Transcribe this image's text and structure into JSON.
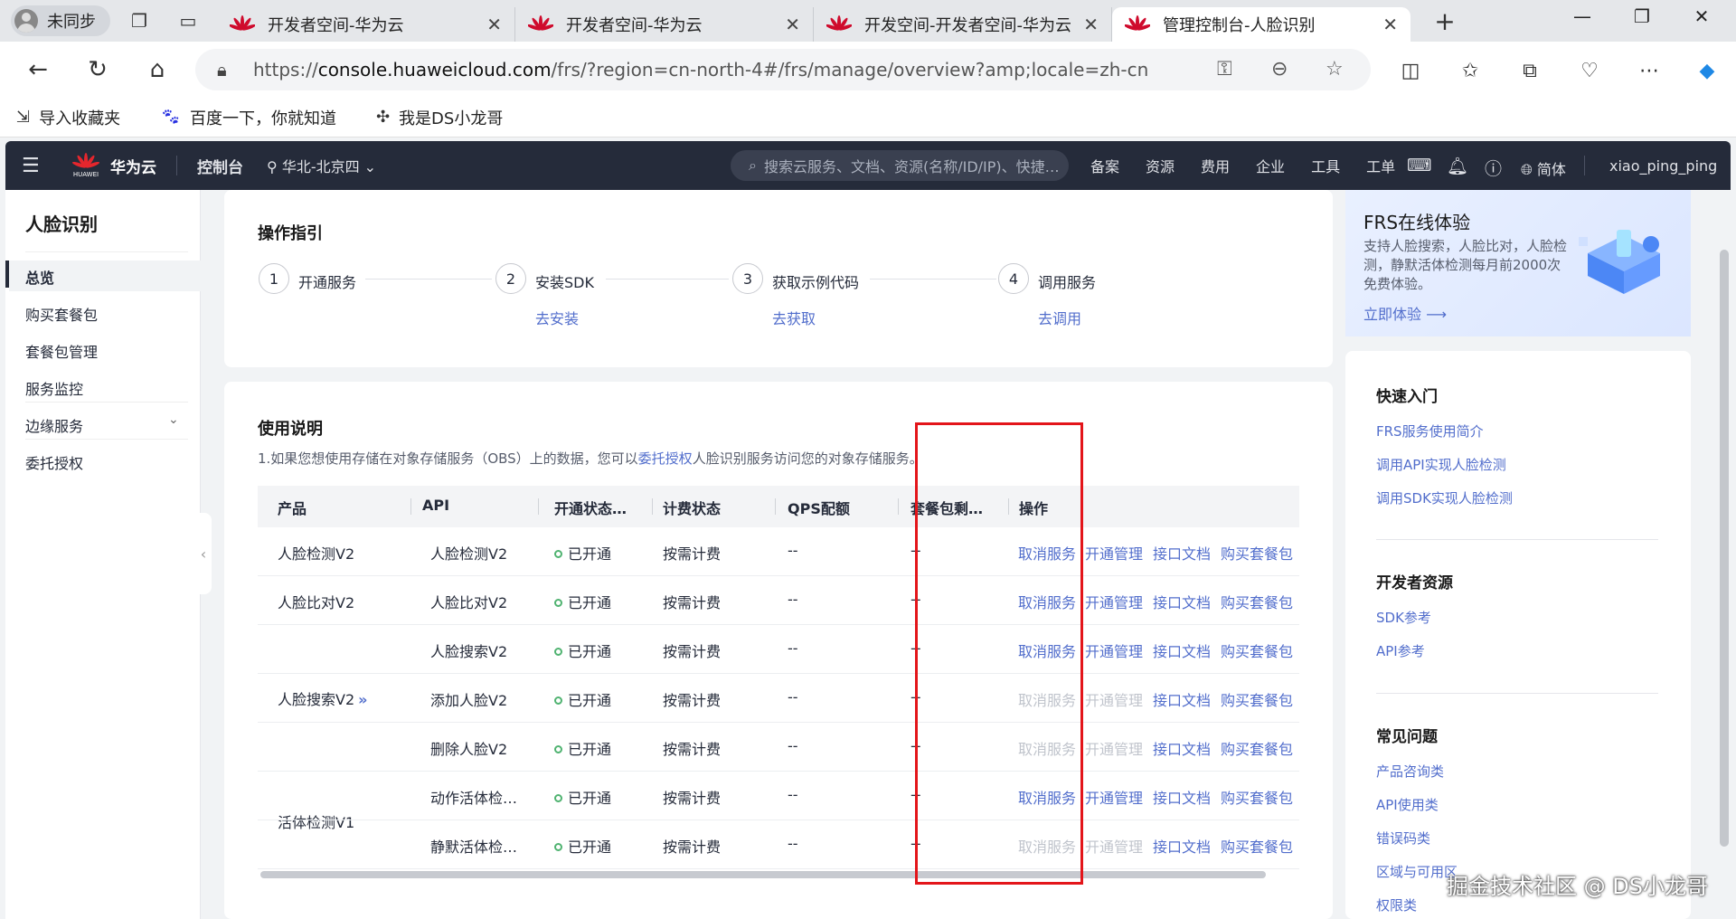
{
  "browser": {
    "profile_label": "未同步",
    "tabs": [
      {
        "label": "开发者空间-华为云"
      },
      {
        "label": "开发者空间-华为云"
      },
      {
        "label": "开发空间-开发者空间-华为云"
      },
      {
        "label": "管理控制台-人脸识别"
      }
    ],
    "url_scheme": "https://",
    "url_host": "console.huaweicloud.com",
    "url_path": "/frs/?region=cn-north-4#/frs/manage/overview?amp;locale=zh-cn",
    "bookmarks": [
      {
        "label": "导入收藏夹"
      },
      {
        "label": "百度一下，你就知道"
      },
      {
        "label": "我是DS小龙哥"
      }
    ]
  },
  "console": {
    "logo_text": "HUAWEI",
    "brand": "华为云",
    "control_label": "控制台",
    "region": "华北-北京四",
    "search_placeholder": "搜索云服务、文档、资源(名称/ID/IP)、快捷…",
    "links": [
      "备案",
      "资源",
      "费用",
      "企业",
      "工具",
      "工单"
    ],
    "language": "简体",
    "username": "xiao_ping_ping"
  },
  "sidebar": {
    "title": "人脸识别",
    "items": [
      {
        "label": "总览"
      },
      {
        "label": "购买套餐包"
      },
      {
        "label": "套餐包管理"
      },
      {
        "label": "服务监控"
      },
      {
        "label": "边缘服务"
      },
      {
        "label": "委托授权"
      }
    ]
  },
  "guide": {
    "title": "操作指引",
    "steps": [
      {
        "num": "1",
        "label": "开通服务",
        "link": ""
      },
      {
        "num": "2",
        "label": "安装SDK",
        "link": "去安装"
      },
      {
        "num": "3",
        "label": "获取示例代码",
        "link": "去获取"
      },
      {
        "num": "4",
        "label": "调用服务",
        "link": "去调用"
      }
    ]
  },
  "usage": {
    "title": "使用说明",
    "desc_before": "1.如果您想使用存储在对象存储服务（OBS）上的数据，您可以",
    "desc_link": "委托授权",
    "desc_after": "人脸识别服务访问您的对象存储服务。",
    "columns": [
      "产品",
      "API",
      "开通状态…",
      "计费状态",
      "QPS配额",
      "套餐包剩…",
      "操作"
    ],
    "products": [
      "人脸检测V2",
      "人脸比对V2",
      "人脸搜索V2",
      "活体检测V1"
    ],
    "rows": [
      {
        "api": "人脸检测V2",
        "status": "已开通",
        "billing": "按需计费",
        "qps": "--",
        "pkg": "--",
        "cancel": "取消服务",
        "manage": "开通管理",
        "doc": "接口文档",
        "buy": "购买套餐包"
      },
      {
        "api": "人脸比对V2",
        "status": "已开通",
        "billing": "按需计费",
        "qps": "--",
        "pkg": "--",
        "cancel": "取消服务",
        "manage": "开通管理",
        "doc": "接口文档",
        "buy": "购买套餐包"
      },
      {
        "api": "人脸搜索V2",
        "status": "已开通",
        "billing": "按需计费",
        "qps": "--",
        "pkg": "--",
        "cancel": "取消服务",
        "manage": "开通管理",
        "doc": "接口文档",
        "buy": "购买套餐包"
      },
      {
        "api": "添加人脸V2",
        "status": "已开通",
        "billing": "按需计费",
        "qps": "--",
        "pkg": "--",
        "cancel": "取消服务",
        "manage": "开通管理",
        "doc": "接口文档",
        "buy": "购买套餐包"
      },
      {
        "api": "删除人脸V2",
        "status": "已开通",
        "billing": "按需计费",
        "qps": "--",
        "pkg": "--",
        "cancel": "取消服务",
        "manage": "开通管理",
        "doc": "接口文档",
        "buy": "购买套餐包"
      },
      {
        "api": "动作活体检…",
        "status": "已开通",
        "billing": "按需计费",
        "qps": "--",
        "pkg": "--",
        "cancel": "取消服务",
        "manage": "开通管理",
        "doc": "接口文档",
        "buy": "购买套餐包"
      },
      {
        "api": "静默活体检…",
        "status": "已开通",
        "billing": "按需计费",
        "qps": "--",
        "pkg": "--",
        "cancel": "取消服务",
        "manage": "开通管理",
        "doc": "接口文档",
        "buy": "购买套餐包"
      }
    ]
  },
  "promo": {
    "title": "FRS在线体验",
    "desc": "支持人脸搜索，人脸比对，人脸检测，静默活体检测每月前2000次免费体验。",
    "link": "立即体验"
  },
  "quickstart": {
    "title": "快速入门",
    "links": [
      "FRS服务使用简介",
      "调用API实现人脸检测",
      "调用SDK实现人脸检测"
    ]
  },
  "devres": {
    "title": "开发者资源",
    "links": [
      "SDK参考",
      "API参考"
    ]
  },
  "faq": {
    "title": "常见问题",
    "links": [
      "产品咨询类",
      "API使用类",
      "错误码类",
      "区域与可用区",
      "权限类"
    ]
  },
  "watermark": "掘金技术社区 @ DS小龙哥",
  "colors": {
    "accent": "#526ecc",
    "header": "#252b3a",
    "highlight": "#e3151a",
    "status_ok": "#50b371"
  }
}
